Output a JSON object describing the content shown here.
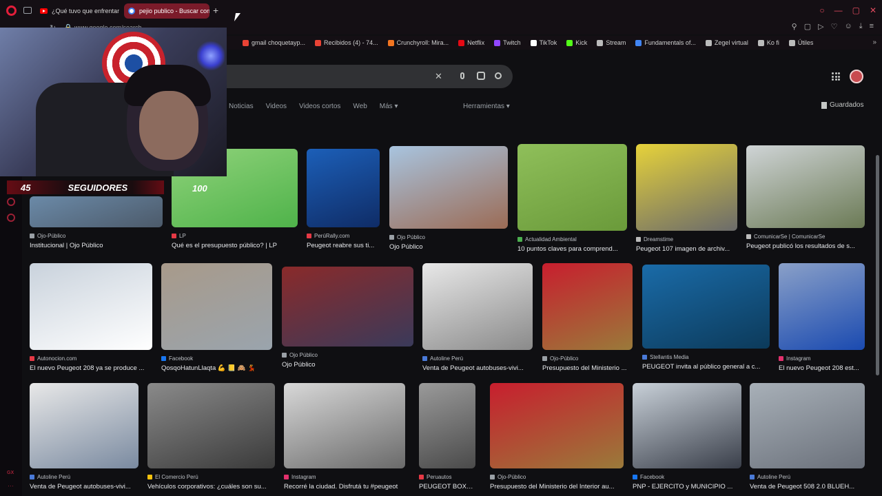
{
  "browser": {
    "tabs": [
      {
        "label": "¿Qué tuvo que enfrentar"
      },
      {
        "label": "pejio publico - Buscar con"
      }
    ],
    "new_tab_label": "+",
    "url": "www.google.com/search",
    "bookmarks": [
      {
        "label": "gmail choquetayp...",
        "color": "#ea4335"
      },
      {
        "label": "Recibidos (4) - 74...",
        "color": "#ea4335"
      },
      {
        "label": "Crunchyroll: Mira...",
        "color": "#f47521"
      },
      {
        "label": "Netflix",
        "color": "#e50914"
      },
      {
        "label": "Twitch",
        "color": "#9146ff"
      },
      {
        "label": "TikTok",
        "color": "#ffffff"
      },
      {
        "label": "Kick",
        "color": "#53fc18"
      },
      {
        "label": "Stream",
        "color": "#bbbbbb"
      },
      {
        "label": "Fundamentals of...",
        "color": "#4285f4"
      },
      {
        "label": "Zegel virtual",
        "color": "#bbbbbb"
      },
      {
        "label": "Ko fi",
        "color": "#bbbbbb"
      },
      {
        "label": "Útiles",
        "color": "#bbbbbb"
      }
    ],
    "sidebar": {
      "gx_label": "GX",
      "more_label": "···"
    }
  },
  "search": {
    "clear_icon": "close-icon",
    "mic_icon": "microphone-icon",
    "lens_icon": "google-lens-icon",
    "search_icon": "search-icon"
  },
  "filters": [
    "Noticias",
    "Videos",
    "Videos cortos",
    "Web",
    "Más ▾"
  ],
  "tools_label": "Herramientas ▾",
  "saved_label": "Guardados",
  "results": [
    {
      "source": "Ojo-Público",
      "title": "Institucional | Ojo Público",
      "colors": [
        "#6b8aa8",
        "#4c5a6a"
      ],
      "src_color": "#9aa0a6"
    },
    {
      "source": "LP",
      "title": "Qué es el presupuesto público? | LP",
      "colors": [
        "#8fd27a",
        "#4fb34a"
      ],
      "src_color": "#e53945"
    },
    {
      "source": "PerúRally.com",
      "title": "Peugeot reabre sus ti...",
      "colors": [
        "#1c5fb8",
        "#0f2c66"
      ],
      "src_color": "#e53945"
    },
    {
      "source": "Ojo Público",
      "title": "Ojo Público",
      "colors": [
        "#a8c4df",
        "#9b6b55"
      ],
      "src_color": "#9aa0a6"
    },
    {
      "source": "Actualidad Ambiental",
      "title": "10 puntos claves para comprend...",
      "colors": [
        "#8fbf5a",
        "#6a9a3a"
      ],
      "src_color": "#4caf50"
    },
    {
      "source": "Dreamstime",
      "title": "Peugeot 107 imagen de archiv...",
      "colors": [
        "#e6d23a",
        "#6b6b6b"
      ],
      "src_color": "#bbbbbb"
    },
    {
      "source": "ComunicarSe | ComunicarSe",
      "title": "Peugeot publicó los resultados de s...",
      "colors": [
        "#cfd4d6",
        "#6b7a55"
      ],
      "src_color": "#bbbbbb"
    },
    {
      "source": "Autonocion.com",
      "title": "El nuevo Peugeot 208 ya se produce ...",
      "colors": [
        "#c9d2dc",
        "#ffffff"
      ],
      "src_color": "#e53945"
    },
    {
      "source": "Facebook",
      "title": "QosqoHatunLlaqta 💪 📒 🙈 💃",
      "colors": [
        "#a89a8a",
        "#9aa4ad"
      ],
      "src_color": "#1877f2"
    },
    {
      "source": "Ojo Público",
      "title": "Ojo Público",
      "colors": [
        "#8a2a2a",
        "#3a3a5a"
      ],
      "src_color": "#9aa0a6"
    },
    {
      "source": "Autoline Perú",
      "title": "Venta de Peugeot autobuses-vivi...",
      "colors": [
        "#e8e8e8",
        "#8a8a8a"
      ],
      "src_color": "#4a7ad8"
    },
    {
      "source": "Ojo-Público",
      "title": "Presupuesto del Ministerio ...",
      "colors": [
        "#c81e2e",
        "#9a7a3a"
      ],
      "src_color": "#9aa0a6"
    },
    {
      "source": "Stellantis Media",
      "title": "PEUGEOT invita al público general a c...",
      "colors": [
        "#1a6ba8",
        "#0c3a5a"
      ],
      "src_color": "#4a7ad8"
    },
    {
      "source": "Instagram",
      "title": "El nuevo Peugeot 208 est...",
      "colors": [
        "#8aa0c8",
        "#1a4ab0"
      ],
      "src_color": "#e1306c"
    },
    {
      "source": "Autoline Perú",
      "title": "Venta de Peugeot autobuses-vivi...",
      "colors": [
        "#e8e8e8",
        "#7a8aa0"
      ],
      "src_color": "#4a7ad8"
    },
    {
      "source": "El Comercio Perú",
      "title": "Vehículos corporativos: ¿cuáles son su...",
      "colors": [
        "#8a8a8a",
        "#3a3a3a"
      ],
      "src_color": "#f4c20d"
    },
    {
      "source": "Instagram",
      "title": "Recorré la ciudad. Disfrutá tu #peugeot",
      "colors": [
        "#d8d8d8",
        "#6a6a6a"
      ],
      "src_color": "#e1306c"
    },
    {
      "source": "Peruautos",
      "title": "PEUGEOT BOXE...",
      "colors": [
        "#9a9a9a",
        "#4a4a4a"
      ],
      "src_color": "#e53945"
    },
    {
      "source": "Ojo-Público",
      "title": "Presupuesto del Ministerio del Interior au...",
      "colors": [
        "#c81e2e",
        "#9a7a3a"
      ],
      "src_color": "#9aa0a6"
    },
    {
      "source": "Facebook",
      "title": "PNP - EJERCITO y MUNICIPIO ...",
      "colors": [
        "#c8d0d8",
        "#3a3f4a"
      ],
      "src_color": "#1877f2"
    },
    {
      "source": "Autoline Perú",
      "title": "Venta de Peugeot 508 2.0 BLUEH...",
      "colors": [
        "#a8b0b8",
        "#6a707a"
      ],
      "src_color": "#4a7ad8"
    }
  ],
  "overlay": {
    "follower_count": "45",
    "follower_label": "SEGUIDORES",
    "goal": "100"
  }
}
